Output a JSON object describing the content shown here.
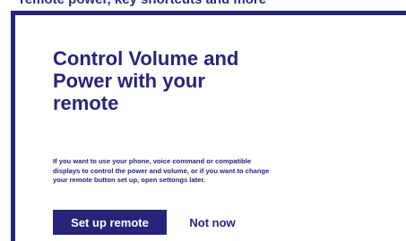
{
  "background_text": "remote power, key shortcuts and more",
  "dialog": {
    "title": "Control Volume and Power with your remote",
    "description": "If you want to use your phone, voice command or compatible\n displays to control the power and volume, or if you want to change\nyour remote button set up, open settongs later.",
    "primary_button": "Set up remote",
    "secondary_button": "Not now"
  },
  "colors": {
    "accent": "#27247a",
    "background": "#ffffff",
    "button_text": "#ffffff"
  }
}
